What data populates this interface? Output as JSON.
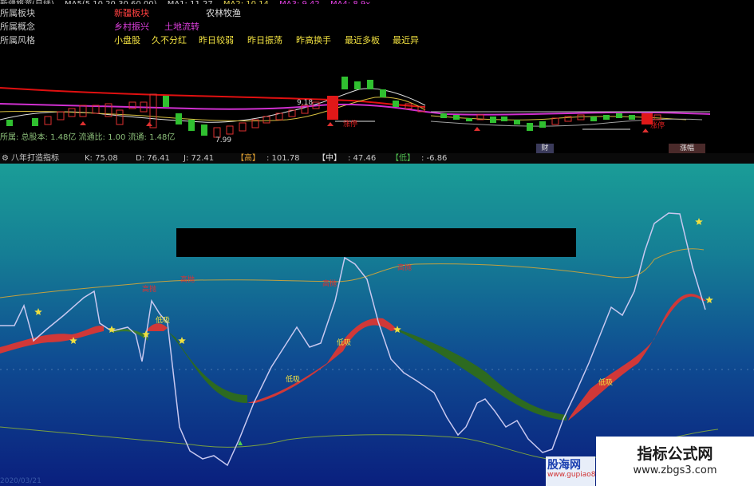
{
  "topbar": {
    "title": "新疆旅游(日线)",
    "ma_label": "MA5(5,10,20,30,60,00)",
    "ma1": "MA1: 11.27",
    "ma2": "MA2: 10.14",
    "ma3": "MA3: 9.42",
    "ma4": "MA4: 8.9x"
  },
  "info": {
    "rows": [
      {
        "label": "所属板块",
        "values": [
          "新疆板块",
          "农林牧渔"
        ],
        "colors": [
          "#ff4040",
          "#e0e0e0"
        ]
      },
      {
        "label": "所属概念",
        "values": [
          "乡村振兴",
          "土地流转"
        ],
        "colors": [
          "#e040e0",
          "#e040e0"
        ]
      },
      {
        "label": "所属风格",
        "values": [
          "小盘股",
          "久不分红",
          "昨日较弱",
          "昨日振荡",
          "昨高换手",
          "最近多板",
          "最近异"
        ],
        "colors": [
          "#f0e040"
        ]
      }
    ],
    "cap_line": "所属: 总股本: 1.48亿  流通比: 1.00  流通: 1.48亿"
  },
  "kline": {
    "price_hi": "9.18",
    "price_lo": "7.99",
    "tag_stop": "涨停",
    "tag_stop2": "涨停",
    "badge_cai": "财",
    "badge_zhang": "涨幅"
  },
  "ticker": {
    "name": "八年打造指标",
    "k": "K: 75.08",
    "d": "D: 76.41",
    "j": "J: 72.41",
    "gao_label": "【高】",
    "gao_val": ": 101.78",
    "zhong_label": "【中】",
    "zhong_val": ": 47.46",
    "di_label": "【低】",
    "di_val": ": -6.86"
  },
  "indicator": {
    "labels": {
      "gao1": "高抛",
      "gao2": "高抛",
      "gao3": "高抛",
      "gao4": "高抛",
      "di1": "低吸",
      "di2": "低吸",
      "di3": "低吸",
      "di4": "低吸"
    }
  },
  "watermark": {
    "title": "指标公式网",
    "url": "www.zbgs3.com",
    "logo": "股海网",
    "logo_url": "www.gupiao8"
  },
  "date": "2020/03/21"
}
